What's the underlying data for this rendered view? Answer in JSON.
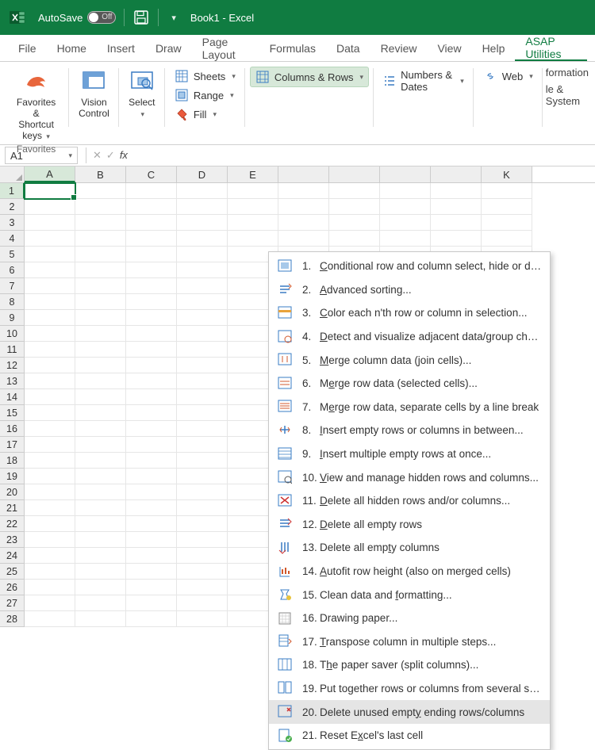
{
  "titlebar": {
    "autosave_label": "AutoSave",
    "autosave_state": "Off",
    "doc_title": "Book1  -  Excel"
  },
  "tabs": {
    "items": [
      "File",
      "Home",
      "Insert",
      "Draw",
      "Page Layout",
      "Formulas",
      "Data",
      "Review",
      "View",
      "Help",
      "ASAP Utilities"
    ],
    "active": 10
  },
  "ribbon": {
    "favorites": {
      "label": "Favorites &\nShortcut keys",
      "group": "Favorites"
    },
    "vision": {
      "label": "Vision\nControl"
    },
    "select": {
      "label": "Select"
    },
    "sheets": "Sheets",
    "range": "Range",
    "fill": "Fill",
    "colrows": "Columns & Rows",
    "numdates": "Numbers & Dates",
    "web": "Web",
    "right": {
      "info": "formation",
      "sys": "le & System"
    }
  },
  "formulabar": {
    "namebox": "A1"
  },
  "grid": {
    "cols": [
      "A",
      "B",
      "C",
      "D",
      "E",
      "",
      "",
      "",
      "",
      "K"
    ],
    "rows": 28,
    "active": {
      "row": 1,
      "col": 0
    }
  },
  "menu": {
    "items": [
      {
        "n": "1",
        "u": "C",
        "rest": "onditional row and column select, hide or delete..."
      },
      {
        "n": "2",
        "u": "A",
        "rest": "dvanced sorting..."
      },
      {
        "n": "3",
        "u": "C",
        "rest": "olor each n'th row or column in selection..."
      },
      {
        "n": "4",
        "u": "D",
        "rest": "etect and visualize adjacent data/group changes..."
      },
      {
        "n": "5",
        "u": "M",
        "rest": "erge column data (join cells)..."
      },
      {
        "n": "6",
        "u": "",
        "pre": "M",
        "u2": "e",
        "rest": "rge row data (selected cells)..."
      },
      {
        "n": "7",
        "u": "",
        "pre": "M",
        "u2": "e",
        "rest": "rge row data, separate cells by a line break",
        "plain": true
      },
      {
        "n": "8",
        "u": "I",
        "rest": "nsert empty rows or columns in between..."
      },
      {
        "n": "9",
        "u": "I",
        "rest": "nsert multiple empty rows at once..."
      },
      {
        "n": "10",
        "u": "V",
        "rest": "iew and manage hidden rows and columns..."
      },
      {
        "n": "11",
        "u": "D",
        "rest": "elete all hidden rows and/or columns..."
      },
      {
        "n": "12",
        "u": "D",
        "rest": "elete all empty rows"
      },
      {
        "n": "13",
        "u": "",
        "pre": "Delete all emp",
        "u2": "t",
        "rest": "y columns"
      },
      {
        "n": "14",
        "u": "A",
        "rest": "utofit row height (also on merged cells)"
      },
      {
        "n": "15",
        "u": "",
        "pre": "Clean data and ",
        "u2": "f",
        "rest": "ormatting..."
      },
      {
        "n": "16",
        "u": "",
        "pre": "Drawin",
        "u2": "g",
        "rest": " paper..."
      },
      {
        "n": "17",
        "u": "T",
        "rest": "ranspose column in multiple steps..."
      },
      {
        "n": "18",
        "u": "",
        "pre": "T",
        "u2": "h",
        "rest": "e paper saver (split columns)..."
      },
      {
        "n": "19",
        "u": "",
        "pre": "Put together rows or columns from several sheets...",
        "plainfull": true
      },
      {
        "n": "20",
        "u": "",
        "pre": "Delete unused empt",
        "u2": "y",
        "rest": " ending rows/columns",
        "hover": true
      },
      {
        "n": "21",
        "u": "",
        "pre": "Reset E",
        "u2": "x",
        "rest": "cel's last cell"
      }
    ]
  }
}
